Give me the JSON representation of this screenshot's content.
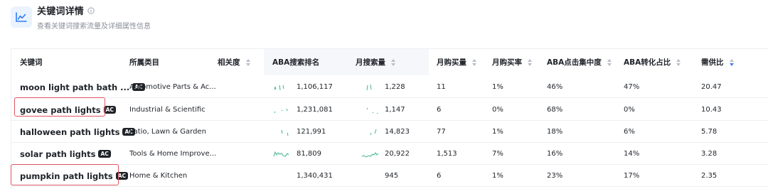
{
  "panel": {
    "title": "关键词详情",
    "subtitle": "查看关键词搜索流量及详细属性信息",
    "accent": "#2f7df6",
    "highlight_color": "#e05563"
  },
  "table": {
    "columns": [
      {
        "key": "keyword",
        "label": "关键词",
        "sortable": false
      },
      {
        "key": "category",
        "label": "所属类目",
        "sortable": false
      },
      {
        "key": "relevance",
        "label": "相关度",
        "sortable": true
      },
      {
        "key": "aba_rank",
        "label": "ABA搜索排名",
        "sortable": false
      },
      {
        "key": "monthly_search",
        "label": "月搜索量",
        "sortable": true
      },
      {
        "key": "monthly_purchase",
        "label": "月购买量",
        "sortable": true
      },
      {
        "key": "purchase_rate",
        "label": "月购买率",
        "sortable": true
      },
      {
        "key": "aba_click_concentration",
        "label": "ABA点击集中度",
        "sortable": true
      },
      {
        "key": "aba_conversion_share",
        "label": "ABA转化占比",
        "sortable": true
      },
      {
        "key": "supply_demand_ratio",
        "label": "需供比",
        "sortable": true,
        "sort_state": "descending"
      }
    ],
    "rows": [
      {
        "keyword": "moon light path bath ...",
        "badge": "AC",
        "category": "Automotive Parts & Ac...",
        "aba_rank": "1,106,117",
        "monthly_search": "1,228",
        "monthly_purchase": "11",
        "purchase_rate": "1%",
        "aba_click_concentration": "46%",
        "aba_conversion_share": "47%",
        "supply_demand_ratio": "20.47",
        "highlighted": false
      },
      {
        "keyword": "govee path lights",
        "badge": "AC",
        "category": "Industrial & Scientific",
        "aba_rank": "1,231,081",
        "monthly_search": "1,147",
        "monthly_purchase": "6",
        "purchase_rate": "0%",
        "aba_click_concentration": "68%",
        "aba_conversion_share": "0%",
        "supply_demand_ratio": "10.43",
        "highlighted": true
      },
      {
        "keyword": "halloween path lights",
        "badge": "AC",
        "category": "Patio, Lawn & Garden",
        "aba_rank": "121,991",
        "monthly_search": "14,823",
        "monthly_purchase": "77",
        "purchase_rate": "1%",
        "aba_click_concentration": "18%",
        "aba_conversion_share": "6%",
        "supply_demand_ratio": "5.78",
        "highlighted": false
      },
      {
        "keyword": "solar path lights",
        "badge": "AC",
        "category": "Tools & Home Improve...",
        "aba_rank": "81,809",
        "monthly_search": "20,922",
        "monthly_purchase": "1,513",
        "purchase_rate": "7%",
        "aba_click_concentration": "16%",
        "aba_conversion_share": "14%",
        "supply_demand_ratio": "3.28",
        "highlighted": false
      },
      {
        "keyword": "pumpkin path lights",
        "badge": "AC",
        "category": "Home & Kitchen",
        "aba_rank": "1,340,431",
        "monthly_search": "945",
        "monthly_purchase": "6",
        "purchase_rate": "1%",
        "aba_click_concentration": "23%",
        "aba_conversion_share": "17%",
        "supply_demand_ratio": "2.35",
        "highlighted": true
      }
    ]
  },
  "icons": {
    "panel_icon": "line-chart-icon",
    "info_icon": "info-circle-icon",
    "sort_icon": "sort-arrows-icon"
  },
  "sparkline_color": "#3db58a"
}
